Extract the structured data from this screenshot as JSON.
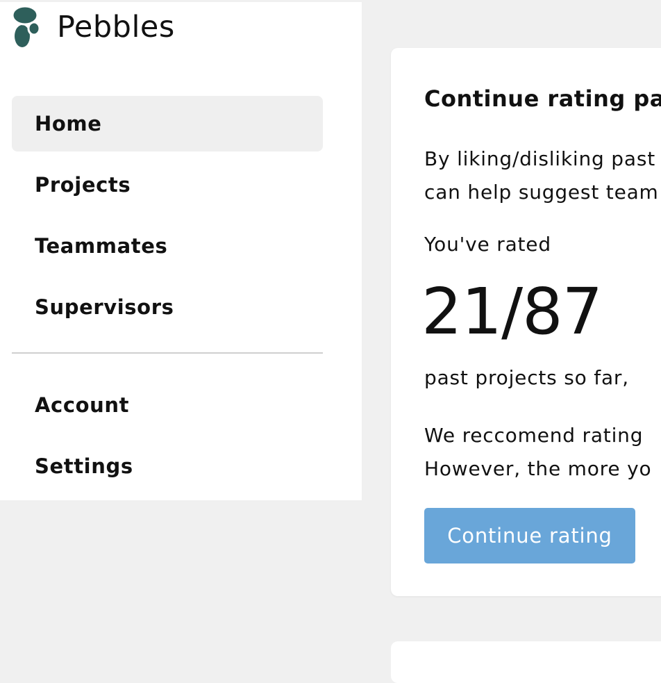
{
  "brand": {
    "name": "Pebbles",
    "logo_icon": "pebbles-logo-icon",
    "logo_color": "#2e5f5b"
  },
  "nav": {
    "primary": [
      {
        "label": "Home",
        "active": true
      },
      {
        "label": "Projects",
        "active": false
      },
      {
        "label": "Teammates",
        "active": false
      },
      {
        "label": "Supervisors",
        "active": false
      }
    ],
    "secondary": [
      {
        "label": "Account"
      },
      {
        "label": "Settings"
      }
    ]
  },
  "card": {
    "title": "Continue rating pas",
    "body_lines": [
      "By liking/disliking past",
      "can help suggest team"
    ],
    "rated_label": "You've rated",
    "count": "21/87",
    "count_suffix": "past projects so far,",
    "recommend_lines": [
      "We reccomend rating",
      "However, the more yo"
    ],
    "cta_label": "Continue rating",
    "cta_color": "#69a6d9"
  },
  "colors": {
    "background": "#f0f0f0",
    "surface": "#ffffff",
    "active_nav": "#efefef",
    "divider": "#cfcfcf"
  }
}
